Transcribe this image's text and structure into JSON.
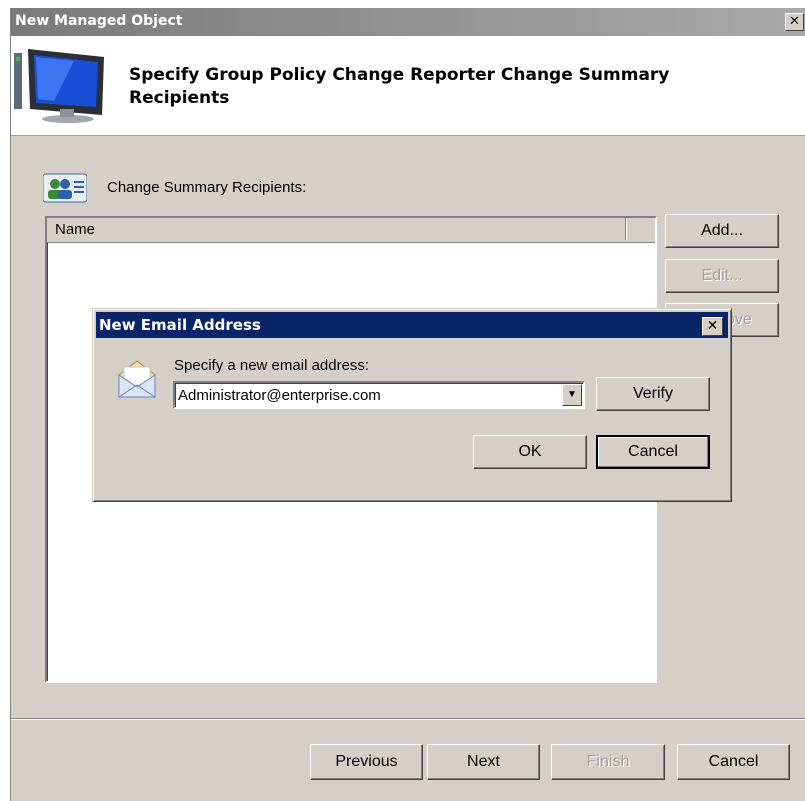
{
  "wizard": {
    "title": "New Managed Object",
    "heading": "Specify Group Policy Change Reporter Change Summary Recipients",
    "section_label": "Change Summary Recipients:",
    "list": {
      "columns": [
        "Name"
      ],
      "rows": []
    },
    "side_buttons": {
      "add": "Add...",
      "edit": "Edit...",
      "remove": "Remove"
    },
    "footer": {
      "previous": "Previous",
      "next": "Next",
      "finish": "Finish",
      "cancel": "Cancel"
    }
  },
  "dialog": {
    "title": "New Email Address",
    "prompt": "Specify a new email address:",
    "email_value": "Administrator@enterprise.com",
    "verify": "Verify",
    "ok": "OK",
    "cancel": "Cancel"
  },
  "icons": {
    "close": "close-icon",
    "monitor": "monitor-icon",
    "users": "users-icon",
    "envelope": "envelope-icon",
    "dropdown": "chevron-down-icon"
  },
  "colors": {
    "dialog_titlebar": "#0a246a",
    "window_face": "#d4d0c8",
    "inactive_titlebar": "#7a7a7a"
  }
}
